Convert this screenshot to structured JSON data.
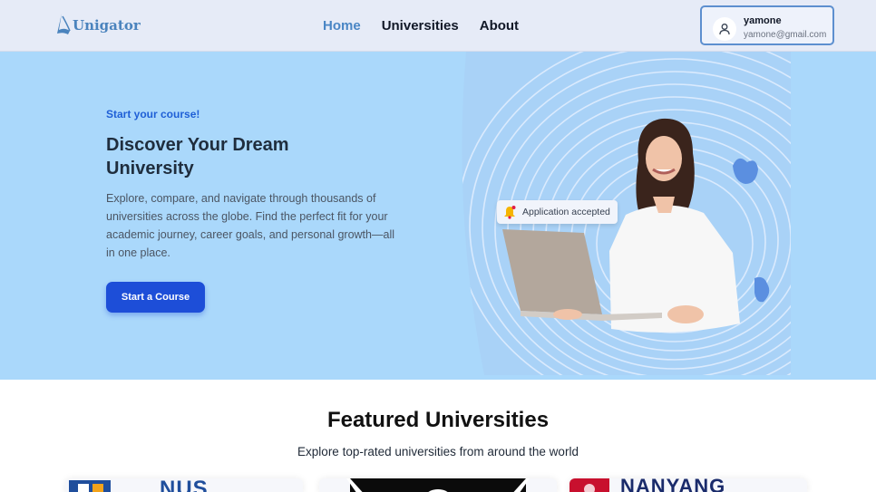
{
  "header": {
    "logo_text": "Unigator",
    "nav": [
      {
        "label": "Home",
        "active": true
      },
      {
        "label": "Universities",
        "active": false
      },
      {
        "label": "About",
        "active": false
      }
    ],
    "user": {
      "name": "yamone",
      "email": "yamone@gmail.com"
    }
  },
  "hero": {
    "eyebrow": "Start your course!",
    "title": "Discover Your Dream University",
    "description": "Explore, compare, and navigate through thousands of universities across the globe. Find the perfect fit for your academic journey, career goals, and personal growth—all in one place.",
    "cta_label": "Start a Course",
    "toast_text": "Application accepted"
  },
  "featured": {
    "title": "Featured Universities",
    "subtitle": "Explore top-rated universities from around the world",
    "cards": [
      {
        "logo_text": "NUS"
      },
      {
        "logo_text": ""
      },
      {
        "logo_text": "NANYANG"
      }
    ]
  },
  "colors": {
    "accent": "#1d4ed8",
    "nav_active": "#4a86c5",
    "hero_bg": "#aad8fb",
    "header_bg": "#e6ebf7"
  },
  "icons": [
    "logo-icon",
    "user-icon",
    "bell-icon"
  ]
}
